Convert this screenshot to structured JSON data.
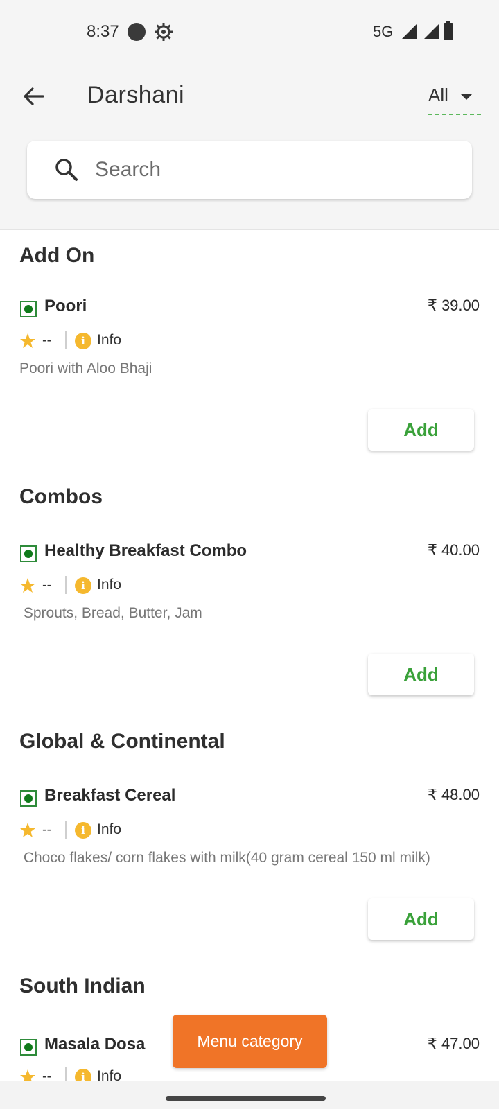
{
  "status_bar": {
    "time": "8:37",
    "network": "5G",
    "icons": [
      "record-dot-icon",
      "gear-icon",
      "signal-hd-icon",
      "signal-hd-icon",
      "battery-icon"
    ]
  },
  "header": {
    "title": "Darshani",
    "back_icon": "arrow-left-icon",
    "filter_label": "All",
    "filter_icon": "caret-down-icon",
    "filter_underline_color": "#5cb85c"
  },
  "search": {
    "placeholder": "Search",
    "icon": "search-icon"
  },
  "sections": [
    {
      "title": "Add On",
      "items": [
        {
          "name": "Poori",
          "price": "₹ 39.00",
          "rating": "--",
          "info_label": "Info",
          "description": "Poori with Aloo Bhaji",
          "add_label": "Add"
        }
      ]
    },
    {
      "title": "Combos",
      "items": [
        {
          "name": "Healthy Breakfast Combo",
          "price": "₹ 40.00",
          "rating": "--",
          "info_label": "Info",
          "description": " Sprouts, Bread, Butter, Jam",
          "add_label": "Add"
        }
      ]
    },
    {
      "title": "Global & Continental",
      "items": [
        {
          "name": "Breakfast Cereal",
          "price": "₹ 48.00",
          "rating": "--",
          "info_label": "Info",
          "description": " Choco flakes/ corn flakes with milk(40 gram cereal 150 ml milk)",
          "add_label": "Add"
        }
      ]
    },
    {
      "title": "South Indian",
      "items": [
        {
          "name": "Masala Dosa",
          "price": "₹ 47.00",
          "rating": "--",
          "info_label": "Info"
        }
      ]
    }
  ],
  "menu_category_button": "Menu category",
  "colors": {
    "accent_green": "#3aa13a",
    "veg_green": "#0f7a1a",
    "star_yellow": "#f5b82e",
    "fab_orange": "#f07427"
  }
}
